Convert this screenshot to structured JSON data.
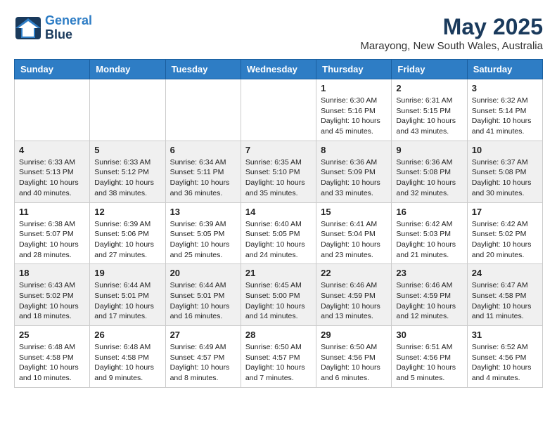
{
  "header": {
    "logo_line1": "General",
    "logo_line2": "Blue",
    "month_title": "May 2025",
    "location": "Marayong, New South Wales, Australia"
  },
  "days_of_week": [
    "Sunday",
    "Monday",
    "Tuesday",
    "Wednesday",
    "Thursday",
    "Friday",
    "Saturday"
  ],
  "weeks": [
    [
      {
        "day": "",
        "info": ""
      },
      {
        "day": "",
        "info": ""
      },
      {
        "day": "",
        "info": ""
      },
      {
        "day": "",
        "info": ""
      },
      {
        "day": "1",
        "info": "Sunrise: 6:30 AM\nSunset: 5:16 PM\nDaylight: 10 hours\nand 45 minutes."
      },
      {
        "day": "2",
        "info": "Sunrise: 6:31 AM\nSunset: 5:15 PM\nDaylight: 10 hours\nand 43 minutes."
      },
      {
        "day": "3",
        "info": "Sunrise: 6:32 AM\nSunset: 5:14 PM\nDaylight: 10 hours\nand 41 minutes."
      }
    ],
    [
      {
        "day": "4",
        "info": "Sunrise: 6:33 AM\nSunset: 5:13 PM\nDaylight: 10 hours\nand 40 minutes."
      },
      {
        "day": "5",
        "info": "Sunrise: 6:33 AM\nSunset: 5:12 PM\nDaylight: 10 hours\nand 38 minutes."
      },
      {
        "day": "6",
        "info": "Sunrise: 6:34 AM\nSunset: 5:11 PM\nDaylight: 10 hours\nand 36 minutes."
      },
      {
        "day": "7",
        "info": "Sunrise: 6:35 AM\nSunset: 5:10 PM\nDaylight: 10 hours\nand 35 minutes."
      },
      {
        "day": "8",
        "info": "Sunrise: 6:36 AM\nSunset: 5:09 PM\nDaylight: 10 hours\nand 33 minutes."
      },
      {
        "day": "9",
        "info": "Sunrise: 6:36 AM\nSunset: 5:08 PM\nDaylight: 10 hours\nand 32 minutes."
      },
      {
        "day": "10",
        "info": "Sunrise: 6:37 AM\nSunset: 5:08 PM\nDaylight: 10 hours\nand 30 minutes."
      }
    ],
    [
      {
        "day": "11",
        "info": "Sunrise: 6:38 AM\nSunset: 5:07 PM\nDaylight: 10 hours\nand 28 minutes."
      },
      {
        "day": "12",
        "info": "Sunrise: 6:39 AM\nSunset: 5:06 PM\nDaylight: 10 hours\nand 27 minutes."
      },
      {
        "day": "13",
        "info": "Sunrise: 6:39 AM\nSunset: 5:05 PM\nDaylight: 10 hours\nand 25 minutes."
      },
      {
        "day": "14",
        "info": "Sunrise: 6:40 AM\nSunset: 5:05 PM\nDaylight: 10 hours\nand 24 minutes."
      },
      {
        "day": "15",
        "info": "Sunrise: 6:41 AM\nSunset: 5:04 PM\nDaylight: 10 hours\nand 23 minutes."
      },
      {
        "day": "16",
        "info": "Sunrise: 6:42 AM\nSunset: 5:03 PM\nDaylight: 10 hours\nand 21 minutes."
      },
      {
        "day": "17",
        "info": "Sunrise: 6:42 AM\nSunset: 5:02 PM\nDaylight: 10 hours\nand 20 minutes."
      }
    ],
    [
      {
        "day": "18",
        "info": "Sunrise: 6:43 AM\nSunset: 5:02 PM\nDaylight: 10 hours\nand 18 minutes."
      },
      {
        "day": "19",
        "info": "Sunrise: 6:44 AM\nSunset: 5:01 PM\nDaylight: 10 hours\nand 17 minutes."
      },
      {
        "day": "20",
        "info": "Sunrise: 6:44 AM\nSunset: 5:01 PM\nDaylight: 10 hours\nand 16 minutes."
      },
      {
        "day": "21",
        "info": "Sunrise: 6:45 AM\nSunset: 5:00 PM\nDaylight: 10 hours\nand 14 minutes."
      },
      {
        "day": "22",
        "info": "Sunrise: 6:46 AM\nSunset: 4:59 PM\nDaylight: 10 hours\nand 13 minutes."
      },
      {
        "day": "23",
        "info": "Sunrise: 6:46 AM\nSunset: 4:59 PM\nDaylight: 10 hours\nand 12 minutes."
      },
      {
        "day": "24",
        "info": "Sunrise: 6:47 AM\nSunset: 4:58 PM\nDaylight: 10 hours\nand 11 minutes."
      }
    ],
    [
      {
        "day": "25",
        "info": "Sunrise: 6:48 AM\nSunset: 4:58 PM\nDaylight: 10 hours\nand 10 minutes."
      },
      {
        "day": "26",
        "info": "Sunrise: 6:48 AM\nSunset: 4:58 PM\nDaylight: 10 hours\nand 9 minutes."
      },
      {
        "day": "27",
        "info": "Sunrise: 6:49 AM\nSunset: 4:57 PM\nDaylight: 10 hours\nand 8 minutes."
      },
      {
        "day": "28",
        "info": "Sunrise: 6:50 AM\nSunset: 4:57 PM\nDaylight: 10 hours\nand 7 minutes."
      },
      {
        "day": "29",
        "info": "Sunrise: 6:50 AM\nSunset: 4:56 PM\nDaylight: 10 hours\nand 6 minutes."
      },
      {
        "day": "30",
        "info": "Sunrise: 6:51 AM\nSunset: 4:56 PM\nDaylight: 10 hours\nand 5 minutes."
      },
      {
        "day": "31",
        "info": "Sunrise: 6:52 AM\nSunset: 4:56 PM\nDaylight: 10 hours\nand 4 minutes."
      }
    ]
  ]
}
